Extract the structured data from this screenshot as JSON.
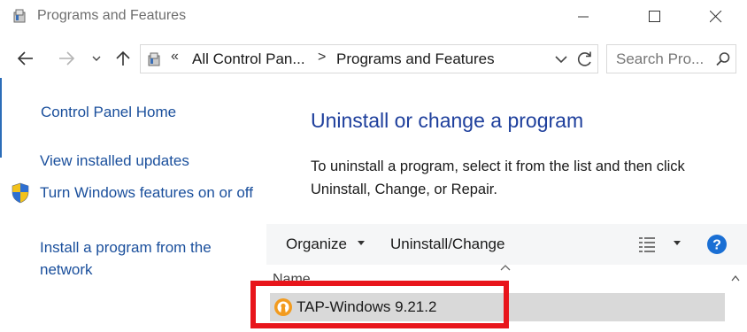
{
  "window": {
    "title": "Programs and Features"
  },
  "address_bar": {
    "overflow_chevron": "«",
    "crumb_root": "All Control Pan...",
    "crumb_separator": ">",
    "crumb_current": "Programs and Features"
  },
  "search": {
    "placeholder": "Search Pro..."
  },
  "left_pane": {
    "home": "Control Panel Home",
    "view_updates": "View installed updates",
    "windows_features": "Turn Windows features on or off",
    "install_network": "Install a program from the network"
  },
  "main": {
    "title": "Uninstall or change a program",
    "description": "To uninstall a program, select it from the list and then click Uninstall, Change, or Repair."
  },
  "toolbar": {
    "organize": "Organize",
    "uninstall_change": "Uninstall/Change"
  },
  "list": {
    "column_name": "Name",
    "rows": [
      {
        "label": "TAP-Windows 9.21.2",
        "icon": "openvpn-icon"
      }
    ]
  },
  "colors": {
    "link": "#1a4f9c",
    "title": "#1e3f9c",
    "highlight_box": "#e8151b",
    "selected_row": "#d9d9d9"
  }
}
